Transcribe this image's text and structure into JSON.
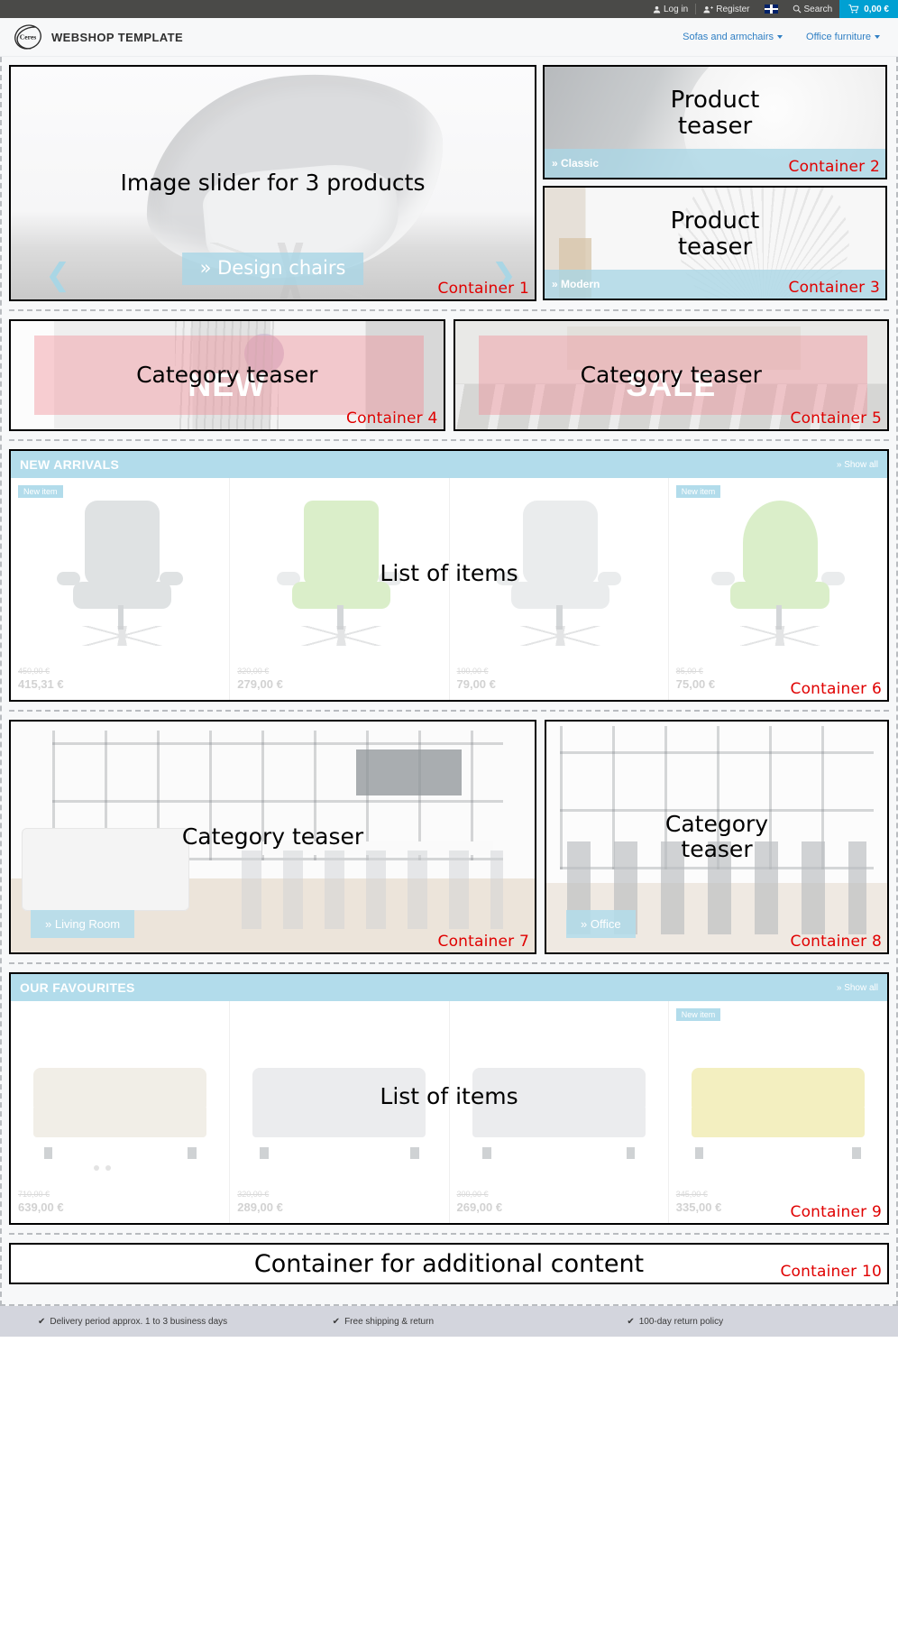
{
  "topbar": {
    "login": "Log in",
    "register": "Register",
    "language_icon": "uk-flag-icon",
    "search": "Search",
    "cart_total": "0,00 €"
  },
  "header": {
    "logo_text": "Ceres",
    "brand": "WEBSHOP TEMPLATE",
    "nav": [
      {
        "label": "Sofas and armchairs"
      },
      {
        "label": "Office furniture"
      }
    ]
  },
  "slider": {
    "overlay_text": "Image slider for 3 products",
    "cta": "» Design chairs",
    "container_label": "Container 1",
    "prev_icon": "chevron-left-icon",
    "next_icon": "chevron-right-icon"
  },
  "teasers": [
    {
      "overlay_text": "Product\nteaser",
      "cta": "» Classic",
      "container_label": "Container 2"
    },
    {
      "overlay_text": "Product\nteaser",
      "cta": "» Modern",
      "container_label": "Container 3"
    }
  ],
  "category_teasers_top": [
    {
      "overlay_text": "Category teaser",
      "word": "NEW",
      "container_label": "Container 4"
    },
    {
      "overlay_text": "Category teaser",
      "word": "SALE",
      "container_label": "Container 5"
    }
  ],
  "new_arrivals": {
    "title": "NEW ARRIVALS",
    "show_all": "» Show all",
    "overlay_text": "List of items",
    "container_label": "Container 6",
    "badge": "New item",
    "items": [
      {
        "old_price": "450,00 €",
        "price": "415,31 €",
        "badge": "New item"
      },
      {
        "old_price": "320,00 €",
        "price": "279,00 €",
        "badge": ""
      },
      {
        "old_price": "100,00 €",
        "price": "79,00 €",
        "badge": ""
      },
      {
        "old_price": "85,00 €",
        "price": "75,00 €",
        "badge": "New item"
      }
    ]
  },
  "category_teasers_mid": [
    {
      "overlay_text": "Category teaser",
      "cta": "» Living Room",
      "container_label": "Container 7"
    },
    {
      "overlay_text": "Category\nteaser",
      "cta": "» Office",
      "container_label": "Container 8"
    }
  ],
  "favourites": {
    "title": "OUR FAVOURITES",
    "show_all": "» Show all",
    "overlay_text": "List of items",
    "container_label": "Container 9",
    "items": [
      {
        "old_price": "710,00 €",
        "price": "639,00 €",
        "badge": ""
      },
      {
        "old_price": "320,00 €",
        "price": "289,00 €",
        "badge": ""
      },
      {
        "old_price": "300,00 €",
        "price": "269,00 €",
        "badge": ""
      },
      {
        "old_price": "345,00 €",
        "price": "335,00 €",
        "badge": "New item"
      }
    ]
  },
  "additional": {
    "text": "Container for additional content",
    "container_label": "Container 10"
  },
  "footer": {
    "items": [
      "Delivery period approx. 1 to 3 business days",
      "Free shipping & return",
      "100-day return policy"
    ]
  },
  "colors": {
    "accent": "#00a0d2",
    "light_blue": "#b2dceb",
    "container_red": "#e00000",
    "topbar_dark": "#4a4a48"
  }
}
